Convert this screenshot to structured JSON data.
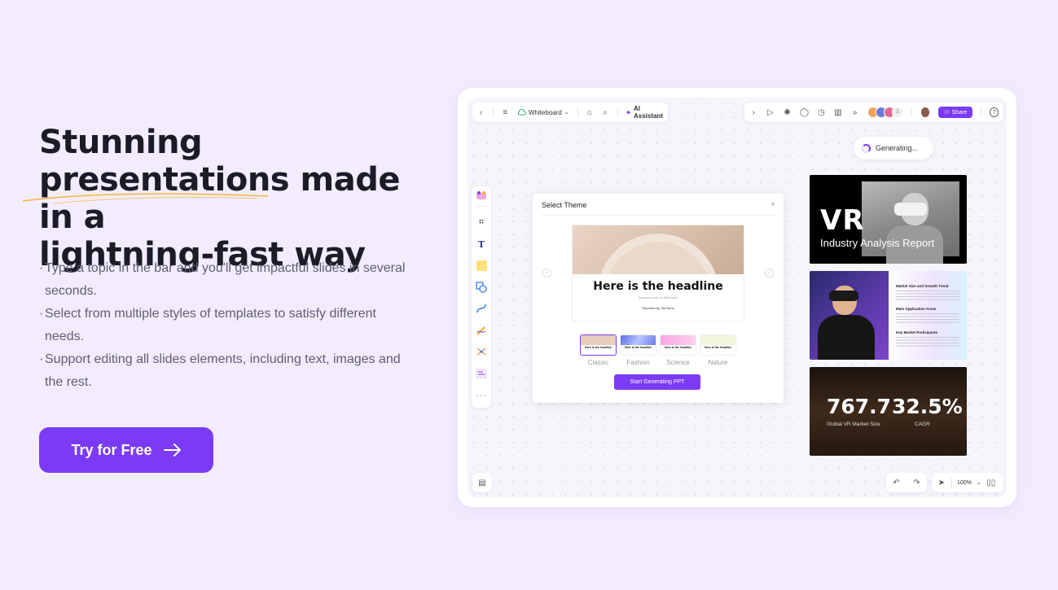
{
  "hero": {
    "title_line1": "Stunning",
    "title_line2": "presentations made in a",
    "title_line3": "lightning-fast way",
    "bullets": [
      "Type a topic in the bar and you'll get impactful slides in several seconds.",
      "Select from multiple styles of templates to satisfy different needs.",
      "Support editing all slides elements, including text, images and the rest."
    ],
    "bullet_mark": "·",
    "cta_label": "Try for Free",
    "underline_color": "#f5b73b"
  },
  "app": {
    "toolbar_left": {
      "back_icon": "chevron-left-icon",
      "menu_icon": "hamburger-icon",
      "board_label": "Whiteboard",
      "tag_icon": "tag-icon",
      "search_icon": "search-icon",
      "ai_label": "AI Assistant"
    },
    "toolbar_right": {
      "avatar_count": "3",
      "share_label": "Share"
    },
    "generating_label": "Generating...",
    "dialog": {
      "title": "Select Theme",
      "slide_headline": "Here is the headline",
      "slide_subtitle": "Speakers can be filled here",
      "slide_reporter": "Reported by:  Be Nunn",
      "themes": [
        {
          "name": "Classic",
          "thumb_text": "Here is the headline",
          "color": "#e8cdbd"
        },
        {
          "name": "Fashion",
          "thumb_text": "Here is the headline",
          "color": "#7a84e6"
        },
        {
          "name": "Science",
          "thumb_text": "Here is the headline",
          "color": "#f7a6e2"
        },
        {
          "name": "Nature",
          "thumb_text": "Here is the headline",
          "color": "#f1f6dc"
        }
      ],
      "generate_label": "Start Generating PPT"
    },
    "cards": {
      "vr_title": "VR",
      "vr_subtitle": "Industry Analysis Report",
      "sections": [
        "Market Size and Growth Trend",
        "Main Application Areas",
        "Key Market Participants"
      ],
      "stat1_value": "767.7",
      "stat1_label": "Global VR Market Size",
      "stat2_value": "32.5%",
      "stat2_label": "CAGR"
    },
    "zoom_label": "100%",
    "accent": "#7b3bf5"
  }
}
